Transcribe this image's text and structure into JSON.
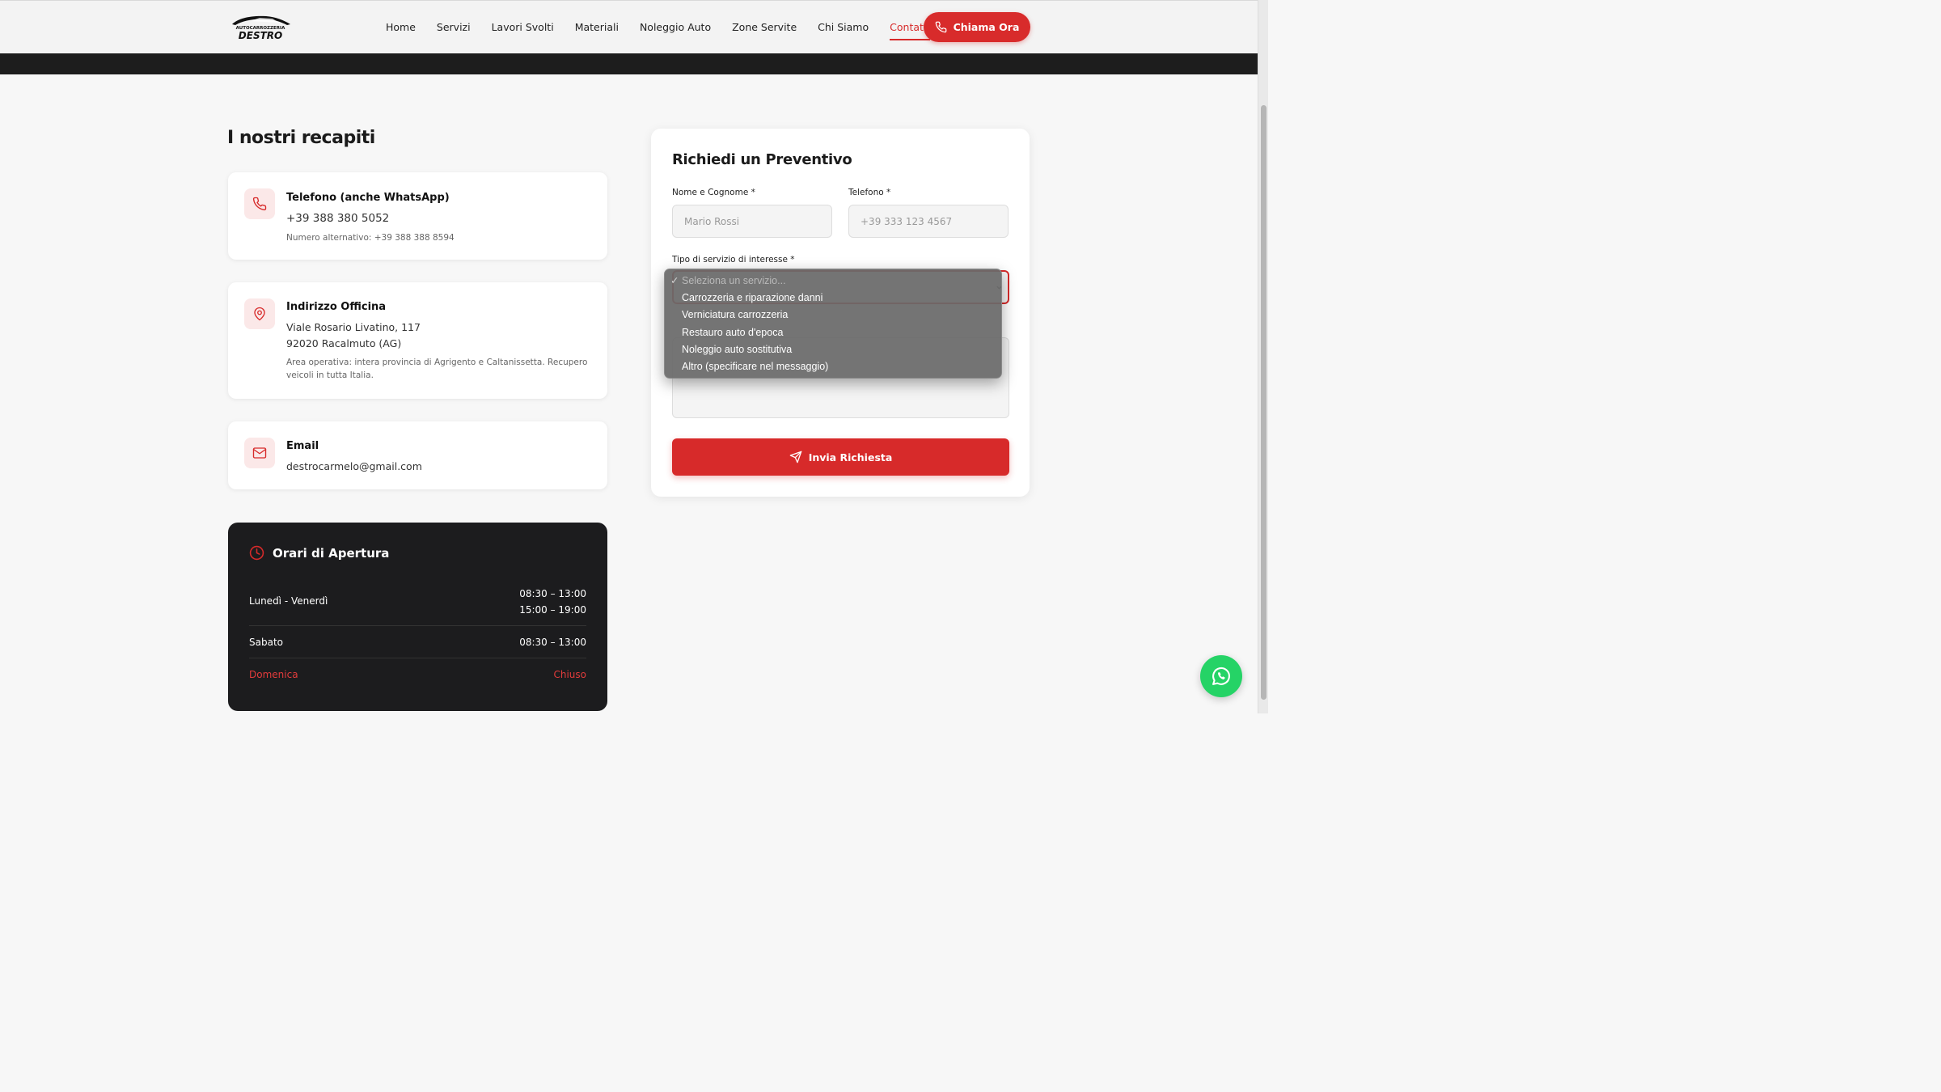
{
  "header": {
    "logo_top": "AUTOCARROZZERIA",
    "logo_main": "DESTRO",
    "nav": [
      {
        "label": "Home",
        "active": false
      },
      {
        "label": "Servizi",
        "active": false
      },
      {
        "label": "Lavori Svolti",
        "active": false
      },
      {
        "label": "Materiali",
        "active": false
      },
      {
        "label": "Noleggio Auto",
        "active": false
      },
      {
        "label": "Zone Servite",
        "active": false
      },
      {
        "label": "Chi Siamo",
        "active": false
      },
      {
        "label": "Contatti",
        "active": true
      }
    ],
    "call_button": "Chiama Ora"
  },
  "contacts": {
    "title": "I nostri recapiti",
    "phone": {
      "icon": "phone-icon",
      "title": "Telefono (anche WhatsApp)",
      "value": "+39 388 380 5052",
      "note": "Numero alternativo: +39 388 388 8594"
    },
    "address": {
      "icon": "map-pin-icon",
      "title": "Indirizzo Officina",
      "line1": "Viale Rosario Livatino, 117",
      "line2": "92020 Racalmuto (AG)",
      "note": "Area operativa: intera provincia di Agrigento e Caltanissetta. Recupero veicoli in tutta Italia."
    },
    "email": {
      "icon": "mail-icon",
      "title": "Email",
      "value": "destrocarmelo@gmail.com"
    }
  },
  "hours": {
    "title": "Orari di Apertura",
    "rows": [
      {
        "day": "Lunedì - Venerdì",
        "time1": "08:30 – 13:00",
        "time2": "15:00 – 19:00"
      },
      {
        "day": "Sabato",
        "time1": "08:30 – 13:00"
      },
      {
        "day": "Domenica",
        "time1": "Chiuso"
      }
    ]
  },
  "form": {
    "title": "Richiedi un Preventivo",
    "name_label": "Nome e Cognome *",
    "name_placeholder": "Mario Rossi",
    "phone_label": "Telefono *",
    "phone_placeholder": "+39 333 123 4567",
    "service_label": "Tipo di servizio di interesse *",
    "submit": "Invia Richiesta",
    "service_options": [
      "Seleziona un servizio...",
      "Carrozzeria e riparazione danni",
      "Verniciatura carrozzeria",
      "Restauro auto d'epoca",
      "Noleggio auto sostitutiva",
      "Altro (specificare nel messaggio)"
    ]
  },
  "colors": {
    "accent": "#d72a2a",
    "dark": "#1c1c1e",
    "whatsapp": "#25d366"
  }
}
